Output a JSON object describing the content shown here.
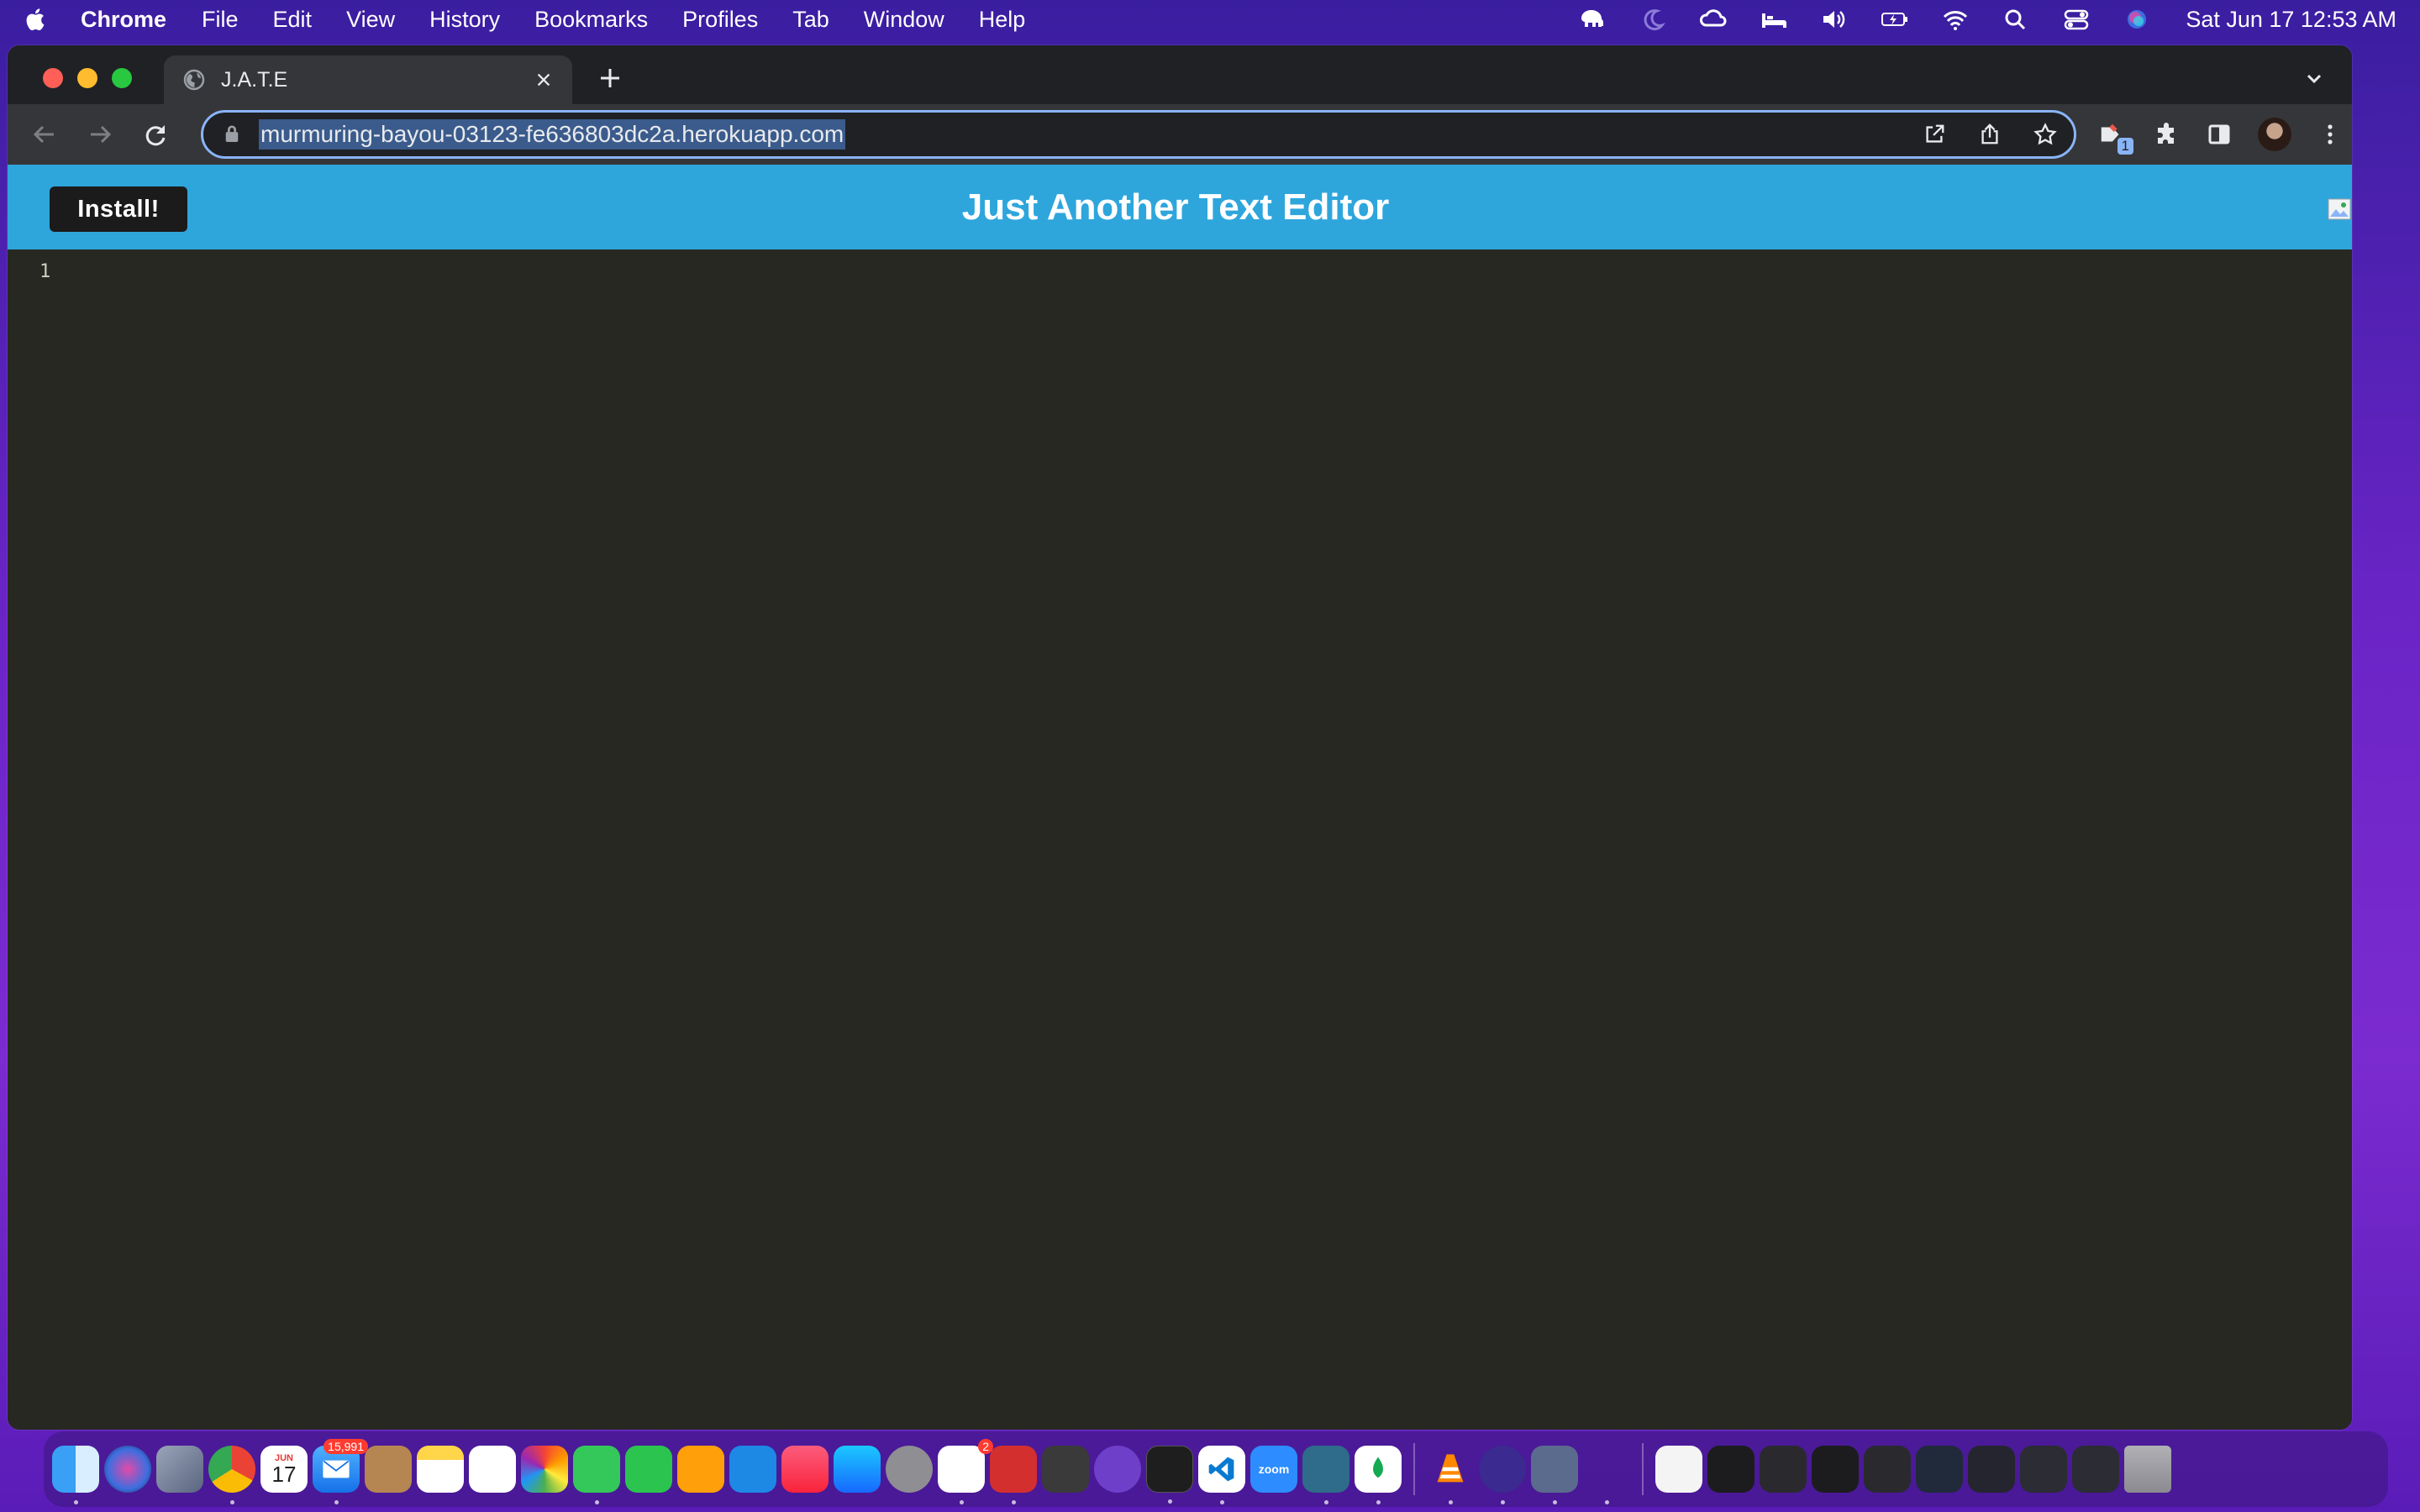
{
  "menubar": {
    "app_name": "Chrome",
    "items": [
      "File",
      "Edit",
      "View",
      "History",
      "Bookmarks",
      "Profiles",
      "Tab",
      "Window",
      "Help"
    ],
    "clock": "Sat Jun 17  12:53 AM"
  },
  "browser": {
    "tab_title": "J.A.T.E",
    "url": "murmuring-bayou-03123-fe636803dc2a.herokuapp.com",
    "extension_badge": "1"
  },
  "app": {
    "install_label": "Install!",
    "title": "Just Another Text Editor",
    "line_number": "1"
  },
  "dock": {
    "calendar_month": "JUN",
    "calendar_day": "17",
    "mail_badge": "15,991",
    "slack_badge": "2",
    "zoom_label": "zoom"
  },
  "colors": {
    "header": "#2ea6dc",
    "editor_bg": "#272822",
    "install_button": "#1b1b1b"
  }
}
